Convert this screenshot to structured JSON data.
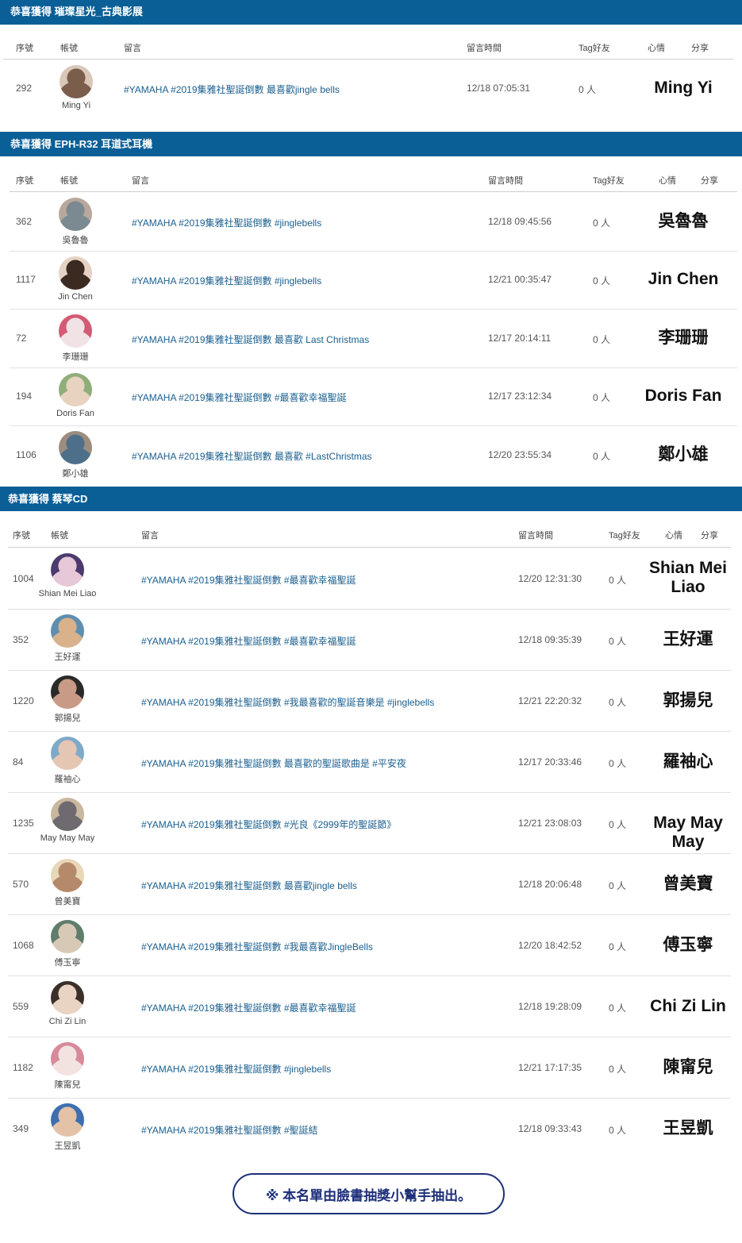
{
  "headers": {
    "seq": "序號",
    "account": "帳號",
    "message": "留言",
    "time": "留言時間",
    "tag": "Tag好友",
    "mood": "心情",
    "share": "分享"
  },
  "sections": [
    {
      "title": "恭喜獲得 璀璨星光_古典影展",
      "rows": [
        {
          "seq": "292",
          "name": "Ming Yi",
          "message": "#YAMAHA #2019集雅社聖誕倒數 最喜歡jingle bells",
          "time": "12/18 07:05:31",
          "tag": "0 人",
          "winner": "Ming Yi",
          "avatar_colors": [
            "#d9c7b8",
            "#7a5d4a"
          ]
        }
      ]
    },
    {
      "title": "恭喜獲得 EPH-R32 耳道式耳機",
      "rows": [
        {
          "seq": "362",
          "name": "吳魯魯",
          "message": "#YAMAHA #2019集雅社聖誕倒數 #jinglebells",
          "time": "12/18 09:45:56",
          "tag": "0 人",
          "winner": "吳魯魯",
          "avatar_colors": [
            "#b9a89c",
            "#7b8a90"
          ]
        },
        {
          "seq": "1117",
          "name": "Jin Chen",
          "message": "#YAMAHA #2019集雅社聖誕倒數 #jinglebells",
          "time": "12/21 00:35:47",
          "tag": "0 人",
          "winner": "Jin Chen",
          "avatar_colors": [
            "#e6d2c4",
            "#3a2a22"
          ]
        },
        {
          "seq": "72",
          "name": "李珊珊",
          "message": "#YAMAHA #2019集雅社聖誕倒數 最喜歡 Last Christmas",
          "time": "12/17 20:14:11",
          "tag": "0 人",
          "winner": "李珊珊",
          "avatar_colors": [
            "#d35b74",
            "#f1e2e6"
          ]
        },
        {
          "seq": "194",
          "name": "Doris Fan",
          "message": "#YAMAHA #2019集雅社聖誕倒數 #最喜歡幸福聖誕",
          "time": "12/17 23:12:34",
          "tag": "0 人",
          "winner": "Doris Fan",
          "avatar_colors": [
            "#8fae7a",
            "#e8d3c0"
          ]
        },
        {
          "seq": "1106",
          "name": "鄭小雄",
          "message": "#YAMAHA #2019集雅社聖誕倒數 最喜歡 #LastChristmas",
          "time": "12/20 23:55:34",
          "tag": "0 人",
          "winner": "鄭小雄",
          "avatar_colors": [
            "#9c8d7f",
            "#4e6f8a"
          ]
        }
      ]
    },
    {
      "title": "恭喜獲得 蔡琴CD",
      "rows": [
        {
          "seq": "1004",
          "name": "Shian Mei Liao",
          "message": "#YAMAHA #2019集雅社聖誕倒數 #最喜歡幸福聖誕",
          "time": "12/20 12:31:30",
          "tag": "0 人",
          "winner": "Shian Mei Liao",
          "avatar_colors": [
            "#4b3b6e",
            "#e7c8d8"
          ]
        },
        {
          "seq": "352",
          "name": "王好運",
          "message": "#YAMAHA #2019集雅社聖誕倒數 #最喜歡幸福聖誕",
          "time": "12/18 09:35:39",
          "tag": "0 人",
          "winner": "王好運",
          "avatar_colors": [
            "#5f8fb0",
            "#d9b28c"
          ]
        },
        {
          "seq": "1220",
          "name": "郭揚兒",
          "message": "#YAMAHA #2019集雅社聖誕倒數 #我最喜歡的聖誕音樂是 #jinglebells",
          "time": "12/21 22:20:32",
          "tag": "0 人",
          "winner": "郭揚兒",
          "avatar_colors": [
            "#2a2a2a",
            "#c99a86"
          ]
        },
        {
          "seq": "84",
          "name": "羅袖心",
          "message": "#YAMAHA #2019集雅社聖誕倒數 最喜歡的聖誕歌曲是 #平安夜",
          "time": "12/17 20:33:46",
          "tag": "0 人",
          "winner": "羅袖心",
          "avatar_colors": [
            "#7fa9c9",
            "#e5c6b3"
          ]
        },
        {
          "seq": "1235",
          "name": "May May May",
          "message": "#YAMAHA #2019集雅社聖誕倒數 #光良《2999年的聖誕節》",
          "time": "12/21 23:08:03",
          "tag": "0 人",
          "winner": "May May May",
          "avatar_colors": [
            "#c9b79f",
            "#6e6a70"
          ]
        },
        {
          "seq": "570",
          "name": "曾美寶",
          "message": "#YAMAHA #2019集雅社聖誕倒數 最喜歡jingle bells",
          "time": "12/18 20:06:48",
          "tag": "0 人",
          "winner": "曾美寶",
          "avatar_colors": [
            "#e8d7b8",
            "#b58a6a"
          ]
        },
        {
          "seq": "1068",
          "name": "傅玉寧",
          "message": "#YAMAHA #2019集雅社聖誕倒數 #我最喜歡JingleBells",
          "time": "12/20 18:42:52",
          "tag": "0 人",
          "winner": "傅玉寧",
          "avatar_colors": [
            "#5f7d6a",
            "#d7c9b6"
          ]
        },
        {
          "seq": "559",
          "name": "Chi Zi Lin",
          "message": "#YAMAHA #2019集雅社聖誕倒數 #最喜歡幸福聖誕",
          "time": "12/18 19:28:09",
          "tag": "0 人",
          "winner": "Chi  Zi Lin",
          "avatar_colors": [
            "#3b2f2a",
            "#e9d3c3"
          ]
        },
        {
          "seq": "1182",
          "name": "陳甯兒",
          "message": "#YAMAHA #2019集雅社聖誕倒數 #jinglebells",
          "time": "12/21 17:17:35",
          "tag": "0 人",
          "winner": "陳甯兒",
          "avatar_colors": [
            "#d78a9a",
            "#f2e3e0"
          ]
        },
        {
          "seq": "349",
          "name": "王昱凱",
          "message": "#YAMAHA #2019集雅社聖誕倒數 #聖誕結",
          "time": "12/18 09:33:43",
          "tag": "0 人",
          "winner": "王昱凱",
          "avatar_colors": [
            "#3d6fb0",
            "#e3c2a8"
          ]
        }
      ]
    }
  ],
  "footer": "※ 本名單由臉書抽獎小幫手抽出。"
}
